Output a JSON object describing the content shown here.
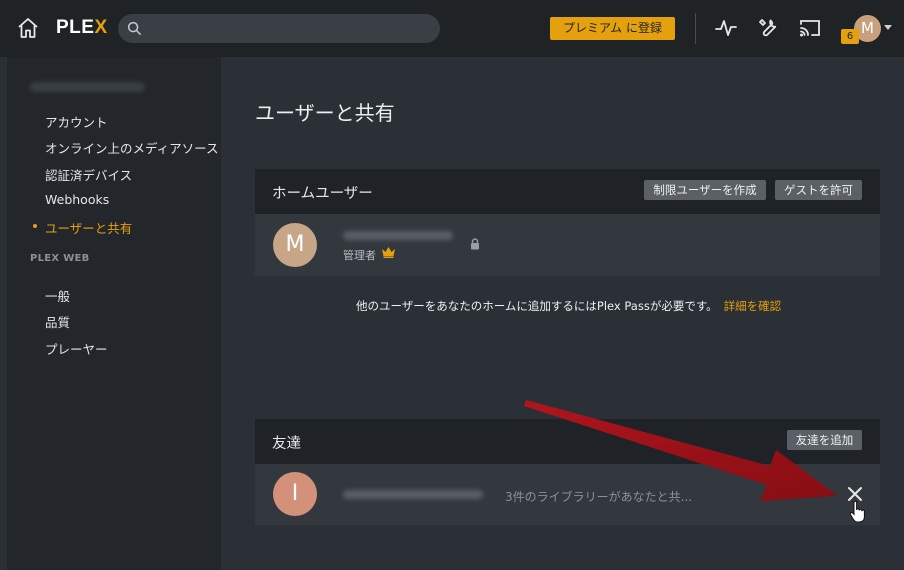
{
  "topbar": {
    "logo_main": "PLE",
    "logo_accent": "X",
    "search_placeholder": "",
    "premium_label": "プレミアム に登録",
    "notification_count": "6",
    "avatar_initial": "M",
    "icons": [
      "home-icon",
      "search-icon",
      "activity-icon",
      "wrench-icon",
      "cast-icon",
      "chevron-down-icon"
    ]
  },
  "sidebar": {
    "items": [
      {
        "label": "アカウント"
      },
      {
        "label": "オンライン上のメディアソース"
      },
      {
        "label": "認証済デバイス"
      },
      {
        "label": "Webhooks"
      },
      {
        "label": "ユーザーと共有"
      }
    ],
    "active_index": 4,
    "section_heading": "PLEX WEB",
    "web_items": [
      {
        "label": "一般"
      },
      {
        "label": "品質"
      },
      {
        "label": "プレーヤー"
      }
    ]
  },
  "main": {
    "title": "ユーザーと共有",
    "home_users": {
      "title": "ホームユーザー",
      "create_restricted_label": "制限ユーザーを作成",
      "allow_guest_label": "ゲストを許可",
      "user": {
        "initial": "M",
        "role": "管理者",
        "avatar_color": "#c7a687"
      },
      "notice_text": "他のユーザーをあなたのホームに追加するにはPlex Passが必要です。",
      "notice_link": "詳細を確認"
    },
    "friends": {
      "title": "友達",
      "add_friend_label": "友達を追加",
      "friend": {
        "initial": "I",
        "share_summary": "3件のライブラリーがあなたと共...",
        "avatar_color": "#d4917a"
      }
    }
  },
  "colors": {
    "accent": "#e5a00d",
    "topbar": "#1f2326",
    "background": "#2b3036",
    "annotation_arrow": "#a8141b"
  }
}
